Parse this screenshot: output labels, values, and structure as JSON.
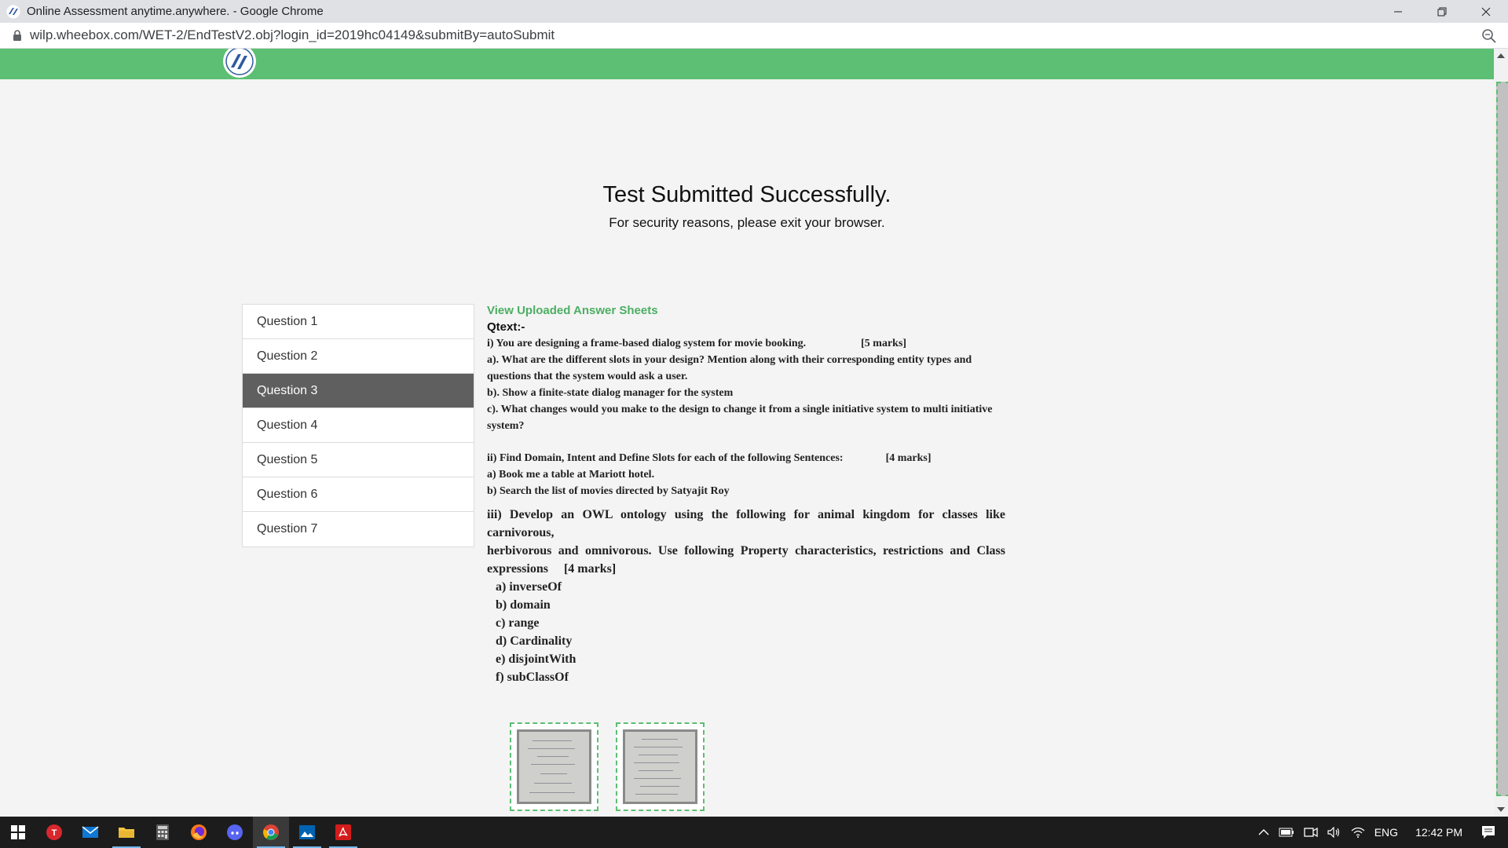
{
  "browser": {
    "window_title": "Online Assessment anytime.anywhere. - Google Chrome",
    "url": "wilp.wheebox.com/WET-2/EndTestV2.obj?login_id=2019hc04149&submitBy=autoSubmit",
    "minimize_icon": "minimize-icon",
    "maximize_icon": "restore-icon",
    "close_icon": "close-icon"
  },
  "page": {
    "heading": "Test Submitted Successfully.",
    "subheading": "For security reasons, please exit your browser.",
    "accent_color": "#5cbf73"
  },
  "questions": {
    "items": [
      "Question 1",
      "Question 2",
      "Question 3",
      "Question 4",
      "Question 5",
      "Question 6",
      "Question 7"
    ],
    "active_index": 2
  },
  "content": {
    "view_sheets_link": "View Uploaded Answer Sheets",
    "qtext_label": "Qtext:-",
    "part1": {
      "title": "i) You are designing a frame-based dialog system for movie booking.",
      "marks": "[5 marks]",
      "a": "a). What are the different slots in your design? Mention along with their corresponding entity types and questions that the system would ask a user.",
      "b": "b). Show a finite-state dialog manager for the system",
      "c": "c). What changes would you make to the design to change it from a single initiative system to multi initiative system?"
    },
    "part2": {
      "title": "ii) Find Domain, Intent and Define Slots for each of the following Sentences:",
      "marks": "[4 marks]",
      "a": "a) Book me a table at Mariott hotel.",
      "b": "b) Search the list of movies directed by Satyajit Roy"
    },
    "part3": {
      "line1": "iii) Develop an OWL ontology using the following for animal kingdom for classes like carnivorous,",
      "line2": "herbivorous and omnivorous. Use following Property characteristics, restrictions and Class expressions",
      "marks": "[4 marks]",
      "items": [
        "a) inverseOf",
        "b) domain",
        "c) range",
        "d) Cardinality",
        "e) disjointWith",
        "f) subClassOf"
      ]
    },
    "answer_sheets": [
      "answer-sheet-1",
      "answer-sheet-2"
    ]
  },
  "taskbar": {
    "icons": [
      "windows-start-icon",
      "todoist-icon",
      "mail-icon",
      "file-explorer-icon",
      "calculator-icon",
      "firefox-icon",
      "discord-icon",
      "chrome-icon",
      "photos-icon",
      "acrobat-icon"
    ],
    "active_icon": "chrome-icon",
    "language": "ENG",
    "time": "12:42 PM"
  }
}
